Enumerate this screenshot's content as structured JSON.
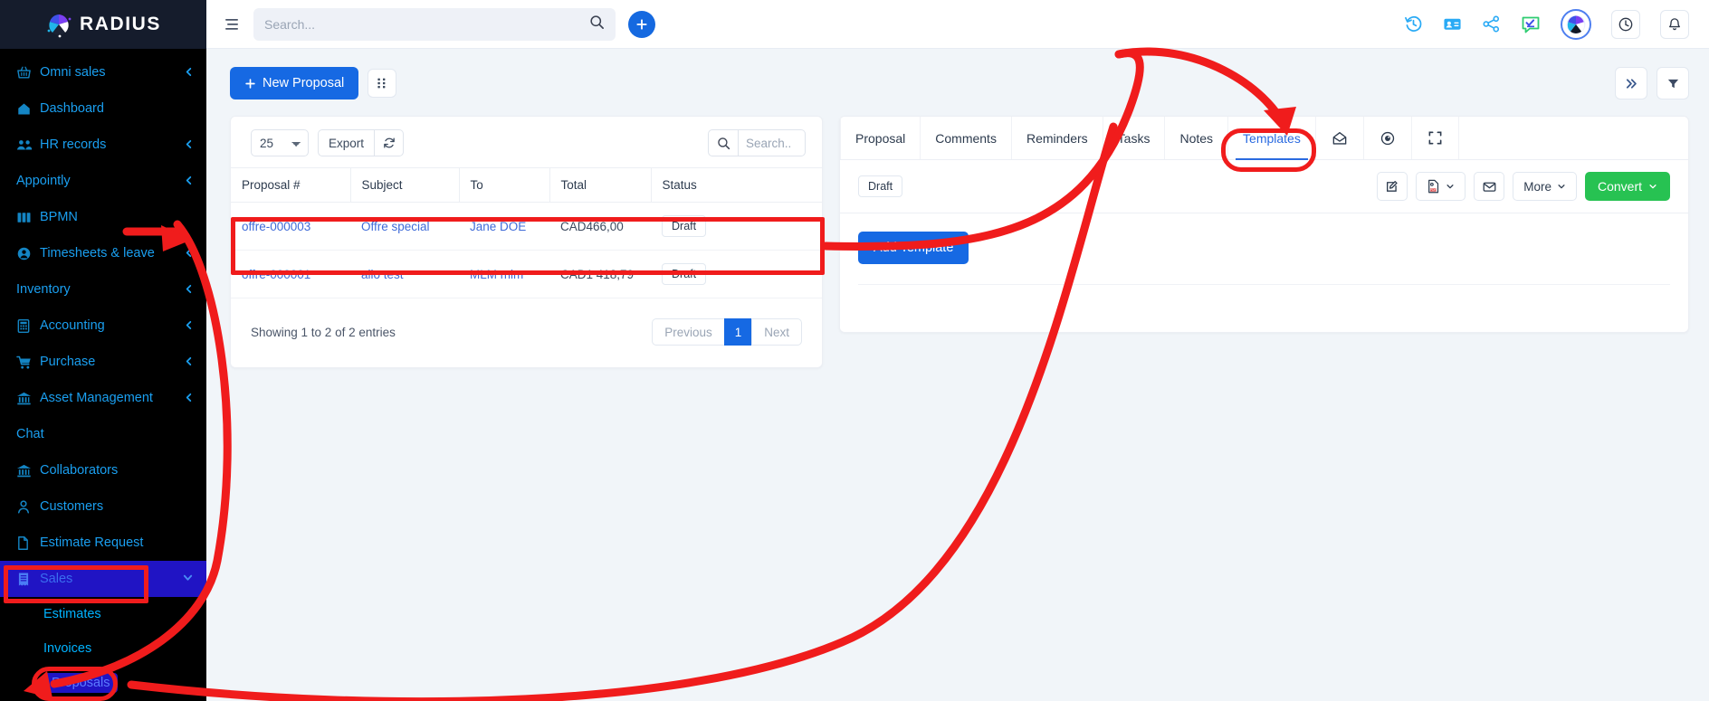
{
  "brand": {
    "name": "RADIUS",
    "logo_icon": "radius-logo-icon"
  },
  "colors": {
    "sidebar_bg": "#000000",
    "logo_bar_bg": "#151c2c",
    "accent_blue": "#1669e3",
    "nav_link": "#1a9ff0",
    "active_nav_bg": "#2014c4",
    "green": "#27c252",
    "annotation_red": "#f01c1c"
  },
  "topbar": {
    "menu_icon": "hamburger-menu-icon",
    "search": {
      "placeholder": "Search...",
      "value": "",
      "icon": "search-icon"
    },
    "add_button_label": "+",
    "icons": [
      {
        "name": "history-icon",
        "glyph": "history"
      },
      {
        "name": "contact-card-icon",
        "glyph": "contact"
      },
      {
        "name": "share-icon",
        "glyph": "share"
      },
      {
        "name": "chat-check-icon",
        "glyph": "chat"
      },
      {
        "name": "user-avatar",
        "glyph": "avatar"
      },
      {
        "name": "clock-icon",
        "glyph": "clock"
      },
      {
        "name": "notification-bell-icon",
        "glyph": "bell"
      }
    ]
  },
  "sidebar": {
    "items": [
      {
        "label": "Omni sales",
        "icon": "basket-icon",
        "chevron": true,
        "has_icon": true
      },
      {
        "label": "Dashboard",
        "icon": "home-icon",
        "chevron": false,
        "has_icon": true
      },
      {
        "label": "HR records",
        "icon": "users-icon",
        "chevron": true,
        "has_icon": true
      },
      {
        "label": "Appointly",
        "icon": "",
        "chevron": true,
        "has_icon": false
      },
      {
        "label": "BPMN",
        "icon": "map-icon",
        "chevron": false,
        "has_icon": true
      },
      {
        "label": "Timesheets & leave",
        "icon": "user-circle-icon",
        "chevron": true,
        "has_icon": true
      },
      {
        "label": "Inventory",
        "icon": "",
        "chevron": true,
        "has_icon": false
      },
      {
        "label": "Accounting",
        "icon": "calculator-icon",
        "chevron": true,
        "has_icon": true
      },
      {
        "label": "Purchase",
        "icon": "cart-icon",
        "chevron": true,
        "has_icon": true
      },
      {
        "label": "Asset Management",
        "icon": "bank-icon",
        "chevron": true,
        "has_icon": true
      },
      {
        "label": "Chat",
        "icon": "",
        "chevron": false,
        "has_icon": false
      },
      {
        "label": "Collaborators",
        "icon": "bank-icon",
        "chevron": false,
        "has_icon": true
      },
      {
        "label": "Customers",
        "icon": "person-icon",
        "chevron": false,
        "has_icon": true
      },
      {
        "label": "Estimate Request",
        "icon": "file-icon",
        "chevron": false,
        "has_icon": true
      }
    ],
    "sales": {
      "label": "Sales",
      "icon": "receipt-icon",
      "chevron_down_icon": "chevron-down-icon",
      "active": true
    },
    "sub_items": [
      {
        "label": "Estimates",
        "highlighted": false
      },
      {
        "label": "Invoices",
        "highlighted": false
      },
      {
        "label": "Proposals",
        "highlighted": true
      }
    ]
  },
  "content": {
    "new_proposal_label": "New Proposal",
    "grid_toggle_icon": "grid-view-icon",
    "collapse_icon": "double-chevron-right-icon",
    "filter_icon": "filter-icon"
  },
  "table_panel": {
    "page_size_value": "25",
    "page_size_options": [
      "25"
    ],
    "export_label": "Export",
    "refresh_icon": "refresh-icon",
    "search": {
      "placeholder": "Search..",
      "value": "",
      "icon": "search-icon"
    },
    "columns": [
      "Proposal #",
      "Subject",
      "To",
      "Total",
      "Status"
    ],
    "rows": [
      {
        "proposal": "offre-000003",
        "subject": "Offre special",
        "to": "Jane DOE",
        "total": "CAD466,00",
        "status": "Draft"
      },
      {
        "proposal": "offre-000001",
        "subject": "allo test",
        "to": "MLM mlm",
        "total": "CAD1 418,79",
        "status": "Draft"
      }
    ],
    "pager": {
      "info": "Showing 1 to 2 of 2 entries",
      "previous": "Previous",
      "current_page": "1",
      "next": "Next"
    }
  },
  "detail_panel": {
    "tabs": [
      {
        "label": "Proposal",
        "active": false
      },
      {
        "label": "Comments",
        "active": false
      },
      {
        "label": "Reminders",
        "active": false
      },
      {
        "label": "Tasks",
        "active": false
      },
      {
        "label": "Notes",
        "active": false
      },
      {
        "label": "Templates",
        "active": true
      }
    ],
    "tab_icons": [
      {
        "name": "envelope-open-icon"
      },
      {
        "name": "eye-icon"
      },
      {
        "name": "fullscreen-icon"
      }
    ],
    "status_badge": "Draft",
    "actions": {
      "edit_icon": "edit-pencil-icon",
      "pdf_icon": "pdf-file-icon",
      "pdf_chevron_icon": "chevron-down-icon",
      "mail_icon": "envelope-icon",
      "more_label": "More",
      "more_chevron_icon": "chevron-down-icon",
      "convert_label": "Convert",
      "convert_chevron_icon": "chevron-down-icon"
    },
    "add_template_label": "Add Template"
  }
}
